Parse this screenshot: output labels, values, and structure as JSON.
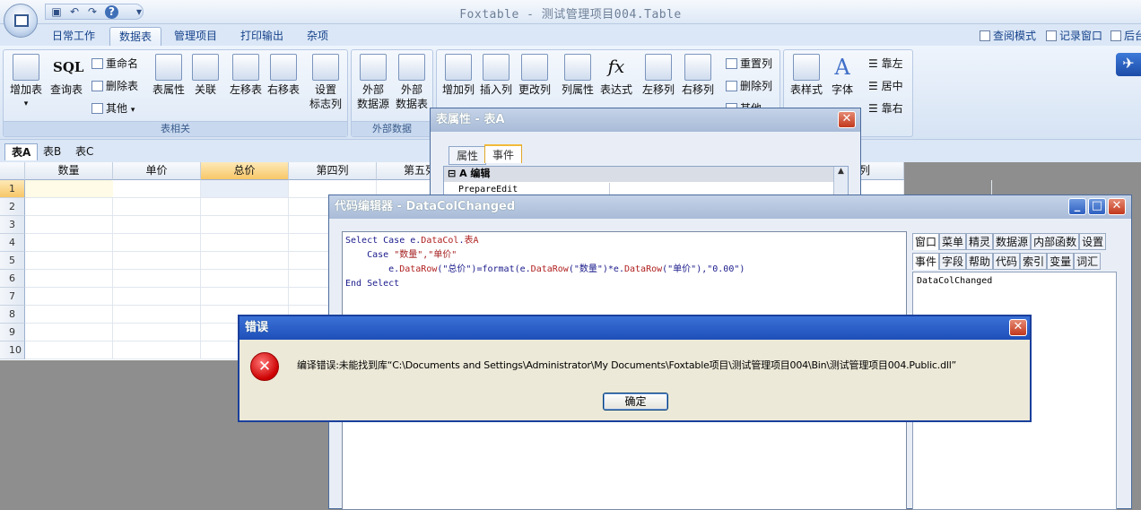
{
  "app": {
    "title": "Foxtable - 测试管理项目004.Table"
  },
  "qat": {
    "dropdown": "▾"
  },
  "tabs": [
    "日常工作",
    "数据表",
    "管理项目",
    "打印输出",
    "杂项"
  ],
  "right_links": [
    "查阅模式",
    "记录窗口",
    "后台"
  ],
  "ribbon": {
    "g1": {
      "label": "表相关",
      "big": [
        "增加表",
        "查询表",
        "表属性",
        "关联",
        "左移表",
        "右移表"
      ],
      "small": [
        "重命名",
        "删除表",
        "其他"
      ],
      "sql": "SQL",
      "setflag": [
        "设置",
        "标志列"
      ],
      "arrow": "▾"
    },
    "g2": {
      "label": "外部数据",
      "big": [
        [
          "外部",
          "数据源"
        ],
        [
          "外部",
          "数据表"
        ]
      ]
    },
    "g3": {
      "big": [
        "增加列",
        "插入列",
        "更改列",
        "列属性",
        "表达式",
        "左移列",
        "右移列"
      ],
      "small": [
        "重置列",
        "删除列",
        "其他"
      ],
      "fx": "fx"
    },
    "g4": {
      "big": [
        "表样式",
        "字体"
      ],
      "small": [
        "靠左",
        "居中",
        "靠右"
      ]
    }
  },
  "sheets": [
    "表A",
    "表B",
    "表C"
  ],
  "grid": {
    "columns": [
      "数量",
      "单价",
      "总价",
      "第四列",
      "第五列",
      "列"
    ],
    "rows": [
      "1",
      "2",
      "3",
      "4",
      "5",
      "6",
      "7",
      "8",
      "9",
      "10"
    ]
  },
  "prop_dialog": {
    "title": "表属性 - 表A",
    "tabs": [
      "属性",
      "事件"
    ],
    "section": "A 编辑",
    "row": "PrepareEdit",
    "collapse": "⊟",
    "scroll_up": "▲"
  },
  "code_editor": {
    "title": "代码编辑器 - DataColChanged",
    "lines": [
      [
        {
          "t": "Select Case e.",
          "c": "kw"
        },
        {
          "t": "DataCol",
          "c": "mb"
        },
        {
          "t": ".",
          "c": "kw"
        },
        {
          "t": "表A",
          "c": "mb"
        }
      ],
      [
        {
          "t": "    Case ",
          "c": "kw"
        },
        {
          "t": "\"数量\",\"单价\"",
          "c": "str"
        }
      ],
      [
        {
          "t": "        e.",
          "c": "kw"
        },
        {
          "t": "DataRow",
          "c": "mb"
        },
        {
          "t": "(\"总价\")=format(e.",
          "c": "kw"
        },
        {
          "t": "DataRow",
          "c": "mb"
        },
        {
          "t": "(\"数量\")*e.",
          "c": "kw"
        },
        {
          "t": "DataRow",
          "c": "mb"
        },
        {
          "t": "(\"单价\"),\"0.00\")",
          "c": "kw"
        }
      ],
      [
        {
          "t": "End Select",
          "c": "kw"
        }
      ]
    ],
    "tabs_row1": [
      "窗口",
      "菜单",
      "精灵",
      "数据源",
      "内部函数",
      "设置"
    ],
    "tabs_row2": [
      "事件",
      "字段",
      "帮助",
      "代码",
      "索引",
      "变量",
      "词汇"
    ],
    "event_item": "DataColChanged"
  },
  "error_dialog": {
    "title": "错误",
    "message": "编译错误:未能找到库“C:\\Documents and Settings\\Administrator\\My Documents\\Foxtable项目\\测试管理项目004\\Bin\\测试管理项目004.Public.dll”",
    "ok": "确定",
    "icon": "✕"
  },
  "window_buttons": {
    "min": "_",
    "max": "□",
    "close": "✕"
  }
}
